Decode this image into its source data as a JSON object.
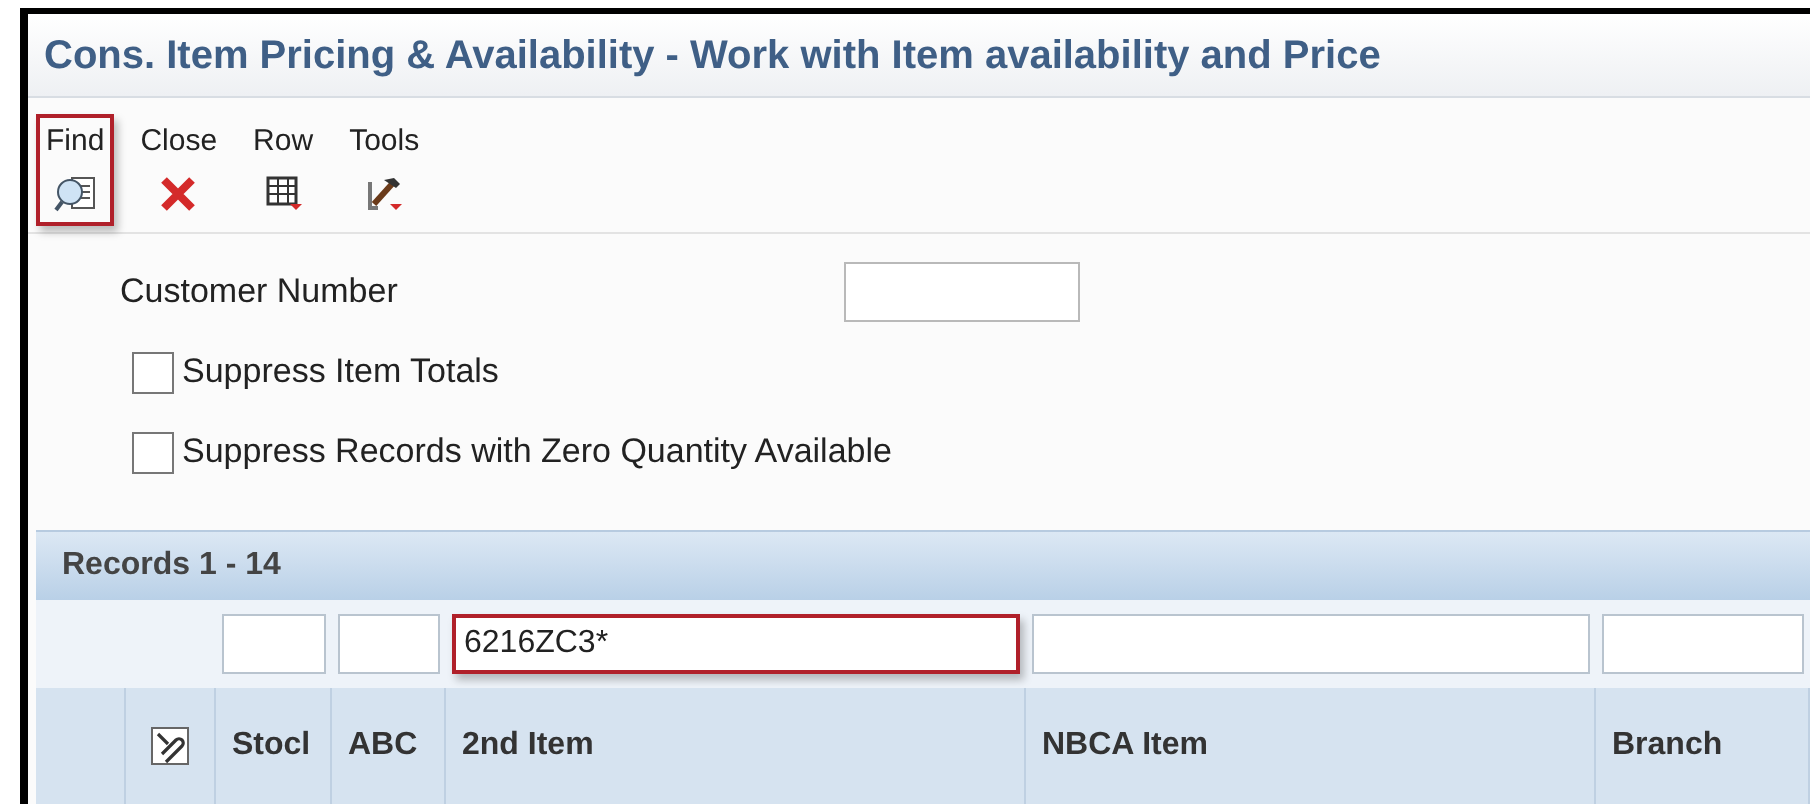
{
  "window": {
    "title": "Cons. Item Pricing & Availability - Work with Item availability and Price"
  },
  "toolbar": [
    {
      "label": "Find",
      "kind": "find",
      "highlighted": true
    },
    {
      "label": "Close",
      "kind": "close",
      "highlighted": false
    },
    {
      "label": "Row",
      "kind": "row",
      "highlighted": false
    },
    {
      "label": "Tools",
      "kind": "tools",
      "highlighted": false
    }
  ],
  "form": {
    "customer_number": {
      "label": "Customer Number"
    },
    "checkboxes": [
      {
        "label": "Suppress Item Totals",
        "checked": false
      },
      {
        "label": "Suppress Records with Zero Quantity Available",
        "checked": false
      }
    ]
  },
  "grid": {
    "title": "Records 1 - 14",
    "columns": [
      {
        "label": "Stocl",
        "highlighted": false
      },
      {
        "label": "ABC",
        "highlighted": false
      },
      {
        "label": "2nd Item",
        "filter": "6216ZC3*",
        "highlighted": true
      },
      {
        "label": "NBCA Item",
        "highlighted": false
      },
      {
        "label": "Branch",
        "highlighted": false
      }
    ]
  }
}
